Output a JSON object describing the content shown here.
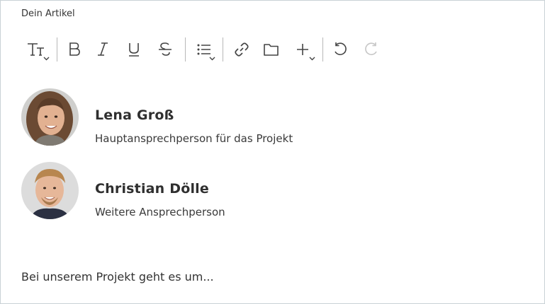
{
  "editor": {
    "field_label": "Dein Artikel",
    "toolbar": [
      {
        "name": "text-style-button",
        "icon": "text-style-icon",
        "dropdown": true
      },
      {
        "name": "bold-button",
        "icon": "bold-icon"
      },
      {
        "name": "italic-button",
        "icon": "italic-icon"
      },
      {
        "name": "underline-button",
        "icon": "underline-icon"
      },
      {
        "name": "strikethrough-button",
        "icon": "strikethrough-icon"
      },
      {
        "name": "list-button",
        "icon": "list-icon",
        "dropdown": true
      },
      {
        "name": "link-button",
        "icon": "link-icon"
      },
      {
        "name": "folder-button",
        "icon": "folder-icon"
      },
      {
        "name": "insert-button",
        "icon": "plus-icon",
        "dropdown": true
      },
      {
        "name": "undo-button",
        "icon": "undo-icon"
      },
      {
        "name": "redo-button",
        "icon": "redo-icon",
        "disabled": true
      }
    ],
    "contacts": [
      {
        "name": "Lena Groß",
        "role": "Hauptansprechperson für das Projekt"
      },
      {
        "name": "Christian Dölle",
        "role": "Weitere Ansprechperson"
      }
    ],
    "body_text": "Bei unserem Projekt geht es um..."
  },
  "colors": {
    "border": "#c9d2d6",
    "icon": "#444444",
    "icon_disabled": "#c6c6c6",
    "text": "#333333"
  }
}
